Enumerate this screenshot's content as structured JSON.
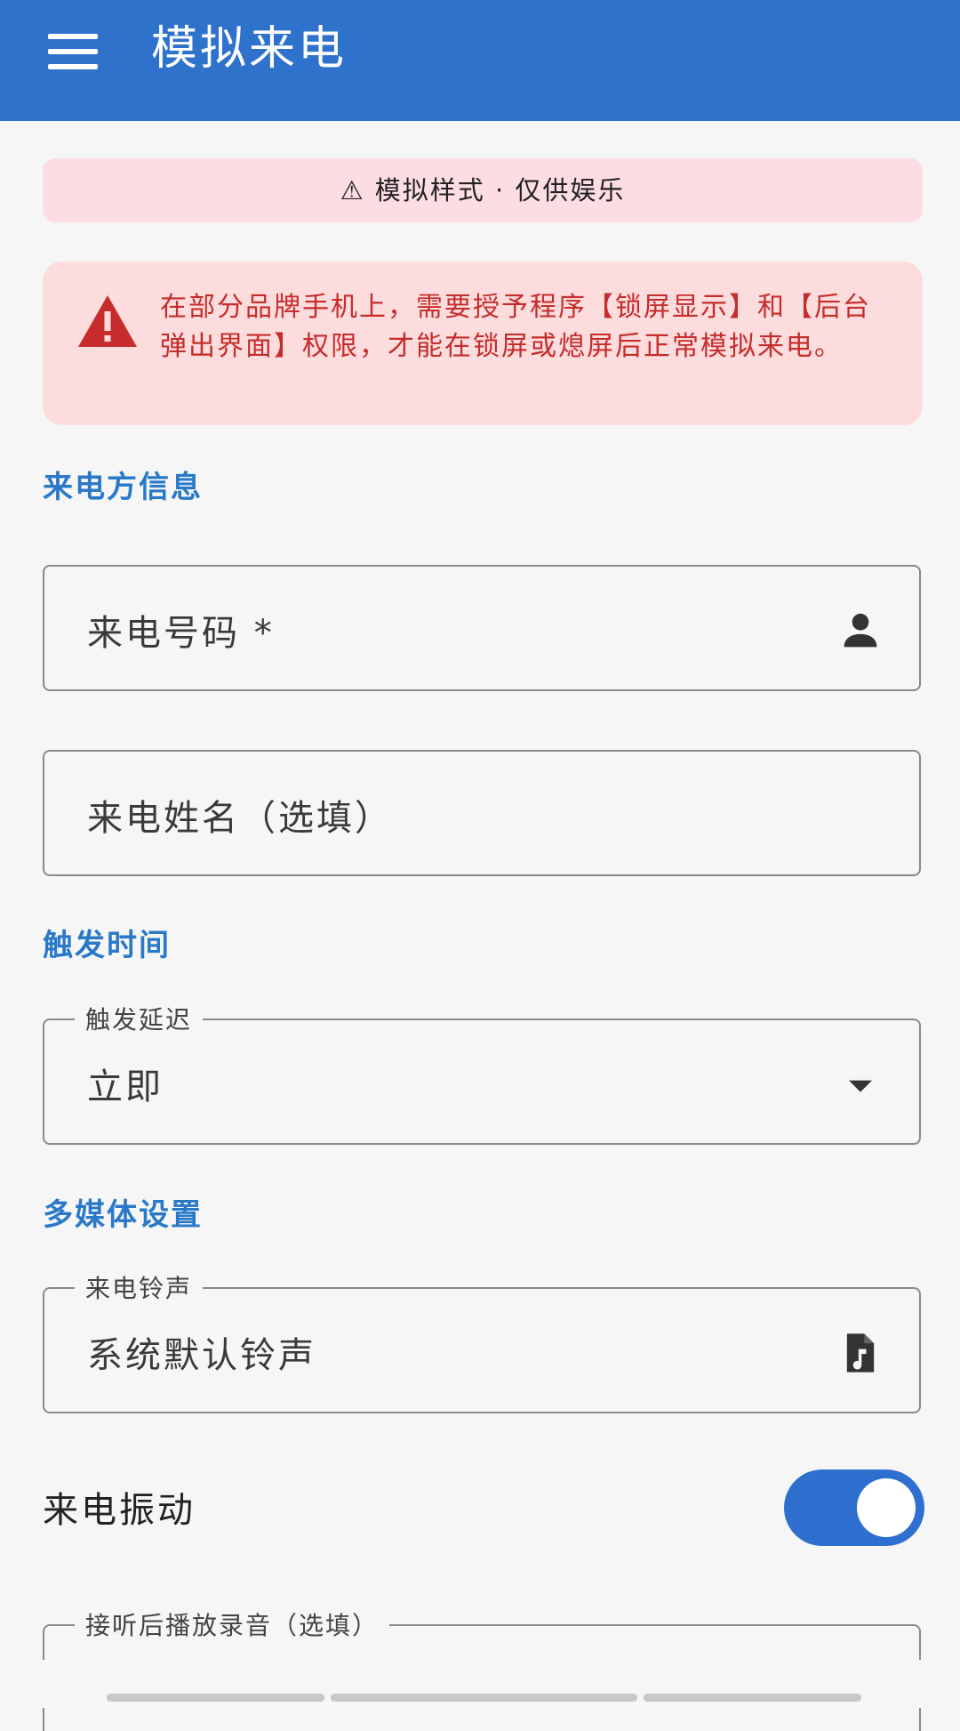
{
  "appbar": {
    "title": "模拟来电",
    "menu_icon": "menu-icon"
  },
  "notice": {
    "text": "⚠ 模拟样式 · 仅供娱乐"
  },
  "warning": {
    "icon": "warning-icon",
    "color": "#c62c2c",
    "text": "在部分品牌手机上，需要授予程序【锁屏显示】和【后台弹出界面】权限，才能在锁屏或熄屏后正常模拟来电。"
  },
  "sections": {
    "caller_info": "来电方信息",
    "trigger_time": "触发时间",
    "media_settings": "多媒体设置"
  },
  "fields": {
    "caller_number": {
      "placeholder": "来电号码 *",
      "icon": "person-icon"
    },
    "caller_name": {
      "placeholder": "来电姓名（选填）"
    },
    "trigger_delay": {
      "label": "触发延迟",
      "value": "立即",
      "icon": "dropdown-arrow-icon"
    },
    "ringtone": {
      "label": "来电铃声",
      "value": "系统默认铃声",
      "icon": "music-file-icon"
    },
    "playback_recording": {
      "label": "接听后播放录音（选填）"
    }
  },
  "vibrate": {
    "label": "来电振动",
    "enabled": true
  },
  "colors": {
    "appbar": "#2e72cc",
    "accent": "#2a79c8",
    "toggle": "#2e6fd0"
  }
}
